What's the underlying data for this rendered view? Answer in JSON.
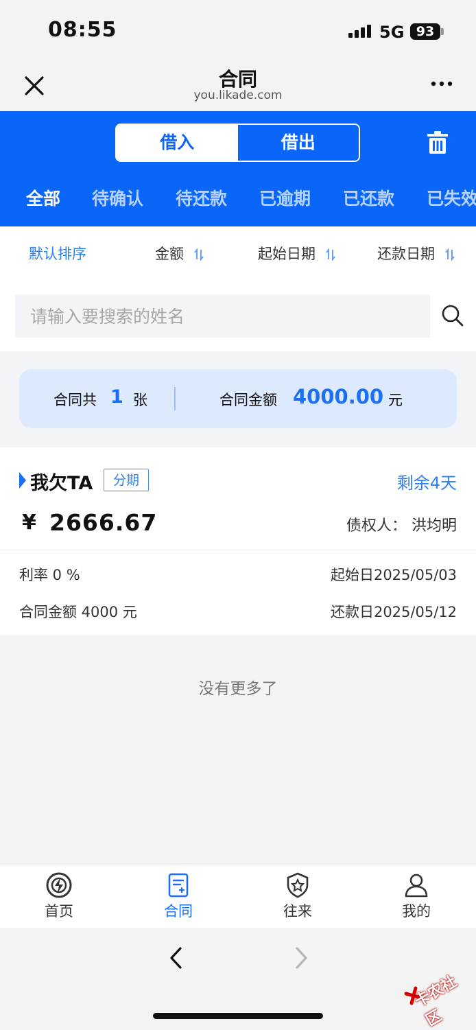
{
  "status_bar": {
    "time": "08:55",
    "network": "5G",
    "battery": "93"
  },
  "nav": {
    "title": "合同",
    "domain": "you.likade.com"
  },
  "segment": {
    "borrow_in": "借入",
    "lend_out": "借出"
  },
  "tabs": [
    "全部",
    "待确认",
    "待还款",
    "已逾期",
    "已还款",
    "已失效"
  ],
  "sort": {
    "default": "默认排序",
    "amount": "金额",
    "start_date": "起始日期",
    "repay_date": "还款日期"
  },
  "search": {
    "placeholder": "请输入要搜索的姓名"
  },
  "summary": {
    "count_label": "合同共",
    "count": "1",
    "count_unit": "张",
    "amount_label": "合同金额",
    "amount": "4000.00",
    "amount_unit": "元"
  },
  "card": {
    "title": "我欠TA",
    "tag": "分期",
    "remaining": "剩余4天",
    "currency": "¥",
    "amount": "2666.67",
    "creditor": "债权人：  洪均明",
    "rate": "利率 0 %",
    "start": "起始日2025/05/03",
    "contract_amount": "合同金额 4000 元",
    "repay": "还款日2025/05/12"
  },
  "no_more": "没有更多了",
  "bottom_nav": [
    "首页",
    "合同",
    "往来",
    "我的"
  ],
  "watermark": "卡农社区",
  "colors": {
    "primary": "#0a66f8",
    "accent": "#1a6ff2",
    "bg": "#f3f4f8"
  }
}
